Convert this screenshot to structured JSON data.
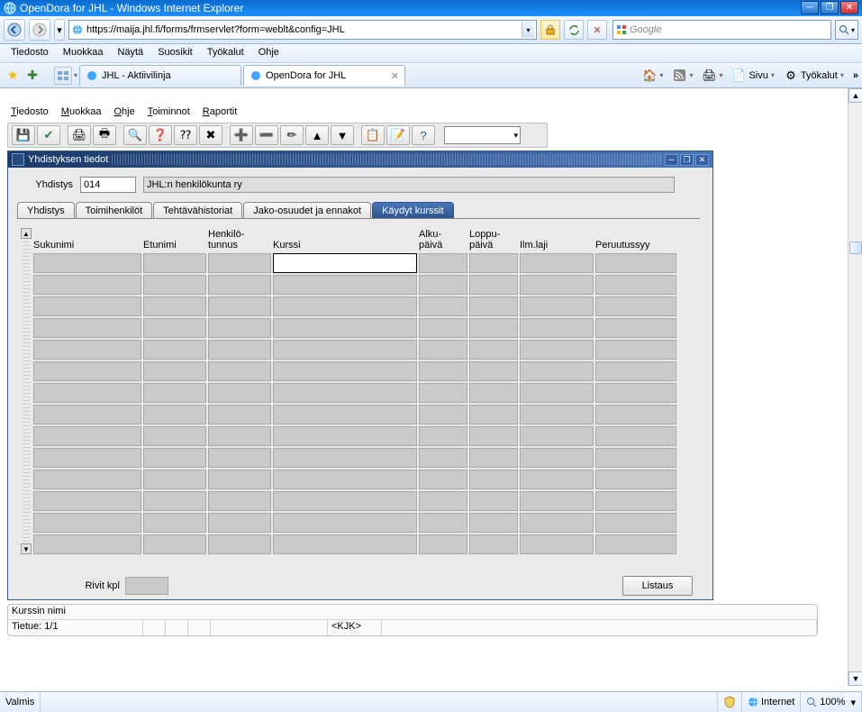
{
  "window": {
    "title": "OpenDora for JHL - Windows Internet Explorer"
  },
  "address": {
    "url": "https://maija.jhl.fi/forms/frmservlet?form=weblt&config=JHL"
  },
  "search": {
    "placeholder": "Google"
  },
  "ie_menu": [
    "Tiedosto",
    "Muokkaa",
    "Näytä",
    "Suosikit",
    "Työkalut",
    "Ohje"
  ],
  "tabs": [
    {
      "label": "JHL - Aktiivilinja",
      "active": false
    },
    {
      "label": "OpenDora for JHL",
      "active": true
    }
  ],
  "command_bar": {
    "home": "",
    "rss": "",
    "print": "",
    "page": "Sivu",
    "tools": "Työkalut",
    "chevron": "»"
  },
  "oracle_menu": [
    {
      "label": "Tiedosto",
      "u": "T"
    },
    {
      "label": "Muokkaa",
      "u": "M"
    },
    {
      "label": "Ohje",
      "u": "O"
    },
    {
      "label": "Toiminnot",
      "u": "T"
    },
    {
      "label": "Raportit",
      "u": "R"
    }
  ],
  "mdi": {
    "title": "Yhdistyksen tiedot"
  },
  "yhdistys": {
    "label": "Yhdistys",
    "code": "014",
    "name": "JHL:n henkilökunta ry"
  },
  "form_tabs": [
    "Yhdistys",
    "Toimihenkilöt",
    "Tehtävähistoriat",
    "Jako-osuudet ja ennakot",
    "Käydyt kurssit"
  ],
  "active_tab_index": 4,
  "grid_headers": {
    "sukunimi": "Sukunimi",
    "etunimi": "Etunimi",
    "tunnus": "Henkilö-\ntunnus",
    "kurssi": "Kurssi",
    "alku": "Alku-\npäivä",
    "loppu": "Loppu-\npäivä",
    "ilm": "Ilm.laji",
    "peru": "Peruutussyy"
  },
  "grid_rows": 14,
  "footer": {
    "rivit_label": "Rivit kpl",
    "listaus": "Listaus"
  },
  "status": {
    "line1": "Kurssin nimi",
    "record": "Tietue: 1/1",
    "brackets": "<KJK>"
  },
  "ie_status": {
    "ready": "Valmis",
    "zone": "Internet",
    "zoom": "100%"
  }
}
